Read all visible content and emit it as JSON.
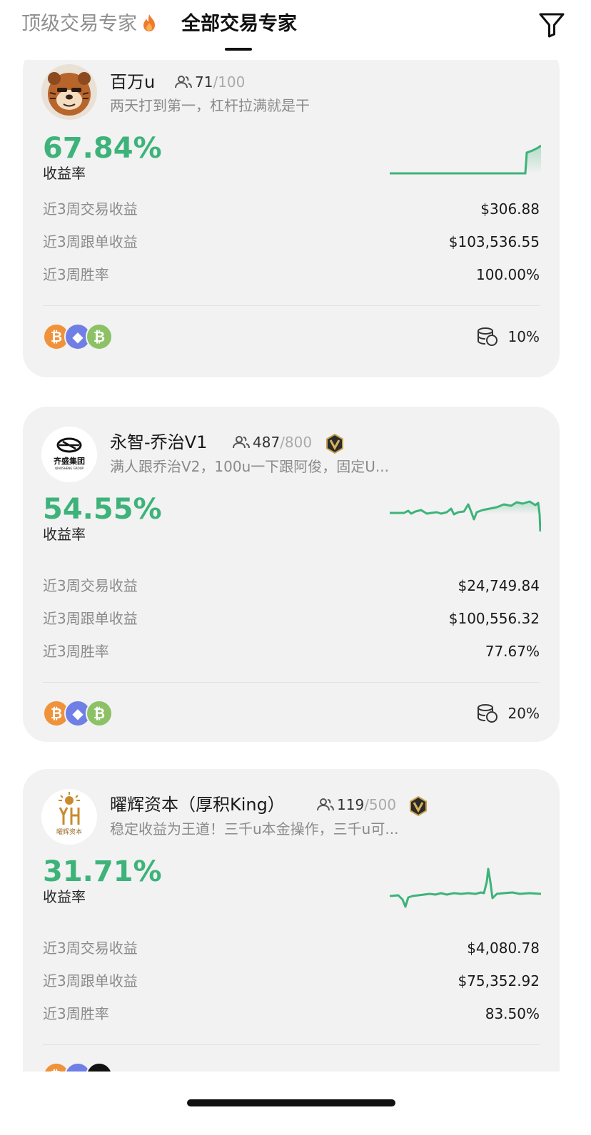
{
  "header": {
    "tab_top": "顶级交易专家",
    "tab_all": "全部交易专家",
    "active_tab": "全部交易专家"
  },
  "traders": [
    {
      "name": "百万u",
      "followers": "71",
      "capacity": "/100",
      "description": "两天打到第一，杠杆拉满就是干",
      "roi": "67.84%",
      "roi_label": "收益率",
      "stats": [
        {
          "label": "近3周交易收益",
          "value": "$306.88"
        },
        {
          "label": "近3周跟单收益",
          "value": "$103,536.55"
        },
        {
          "label": "近3周胜率",
          "value": "100.00%"
        }
      ],
      "coins": [
        "btc",
        "eth",
        "bch"
      ],
      "profit_share": "10%",
      "verified": false
    },
    {
      "name": "永智-乔治V1",
      "followers": "487",
      "capacity": "/800",
      "description": "满人跟乔治V2，100u一下跟阿俊，固定U...",
      "roi": "54.55%",
      "roi_label": "收益率",
      "stats": [
        {
          "label": "近3周交易收益",
          "value": "$24,749.84"
        },
        {
          "label": "近3周跟单收益",
          "value": "$100,556.32"
        },
        {
          "label": "近3周胜率",
          "value": "77.67%"
        }
      ],
      "coins": [
        "btc",
        "eth",
        "bch"
      ],
      "profit_share": "20%",
      "verified": true,
      "avatar_text": "齐盛集团",
      "avatar_subtext": "QIAOSHENG GROUP"
    },
    {
      "name": "曜辉资本（厚积King）",
      "followers": "119",
      "capacity": "/500",
      "description": "稳定收益为王道！三千u本金操作，三千u可...",
      "roi": "31.71%",
      "roi_label": "收益率",
      "stats": [
        {
          "label": "近3周交易收益",
          "value": "$4,080.78"
        },
        {
          "label": "近3周跟单收益",
          "value": "$75,352.92"
        },
        {
          "label": "近3周胜率",
          "value": "83.50%"
        }
      ],
      "coins": [
        "btc",
        "eth",
        "black"
      ],
      "verified": true,
      "avatar_text": "曜辉资本"
    }
  ],
  "colors": {
    "accent_green": "#3db37a",
    "card_bg": "#f2f2f2",
    "btc": "#f0923a",
    "eth": "#6f7fe6",
    "bch": "#8dc165"
  }
}
